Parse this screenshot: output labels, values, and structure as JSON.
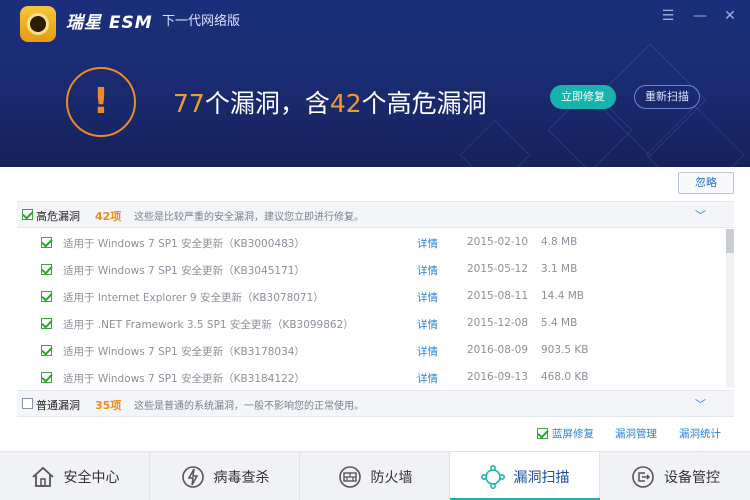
{
  "app": {
    "brand": "瑞星 ESM",
    "subtitle": "下一代网络版"
  },
  "summary": {
    "count_total": "77",
    "text_mid": "个漏洞，含",
    "count_high": "42",
    "text_end": "个高危漏洞",
    "fix_button": "立即修复",
    "rescan_button": "重新扫描"
  },
  "ignore_button": "忽略",
  "categories": [
    {
      "title": "高危漏洞",
      "count": "42项",
      "desc": "这些是比较严重的安全漏洞，建议您立即进行修复。",
      "checked": true
    },
    {
      "title": "普通漏洞",
      "count": "35项",
      "desc": "这些是普通的系统漏洞，一般不影响您的正常使用。",
      "checked": false
    }
  ],
  "rows": [
    {
      "name": "适用于 Windows 7 SP1 安全更新（KB3000483）",
      "detail": "详情",
      "date": "2015-02-10",
      "size": "4.8 MB"
    },
    {
      "name": "适用于 Windows 7 SP1 安全更新（KB3045171）",
      "detail": "详情",
      "date": "2015-05-12",
      "size": "3.1 MB"
    },
    {
      "name": "适用于 Internet Explorer 9 安全更新（KB3078071）",
      "detail": "详情",
      "date": "2015-08-11",
      "size": "14.4 MB"
    },
    {
      "name": "适用于 .NET Framework 3.5 SP1 安全更新（KB3099862）",
      "detail": "详情",
      "date": "2015-12-08",
      "size": "5.4 MB"
    },
    {
      "name": "适用于 Windows 7 SP1 安全更新（KB3178034）",
      "detail": "详情",
      "date": "2016-08-09",
      "size": "903.5 KB"
    },
    {
      "name": "适用于 Windows 7 SP1 安全更新（KB3184122）",
      "detail": "详情",
      "date": "2016-09-13",
      "size": "468.0 KB"
    }
  ],
  "footer": {
    "bluescreen_fix": "蓝屏修复",
    "manage": "漏洞管理",
    "stats": "漏洞统计"
  },
  "nav": [
    {
      "label": "安全中心",
      "icon": "house-icon"
    },
    {
      "label": "病毒查杀",
      "icon": "lightning-icon"
    },
    {
      "label": "防火墙",
      "icon": "firewall-icon"
    },
    {
      "label": "漏洞扫描",
      "icon": "network-scan-icon",
      "active": true
    },
    {
      "label": "设备管控",
      "icon": "device-icon"
    }
  ],
  "colors": {
    "accent_teal": "#18b3ad",
    "warning_orange": "#f08a24",
    "header_blue": "#1b2f7c",
    "link_blue": "#2b83d6"
  }
}
